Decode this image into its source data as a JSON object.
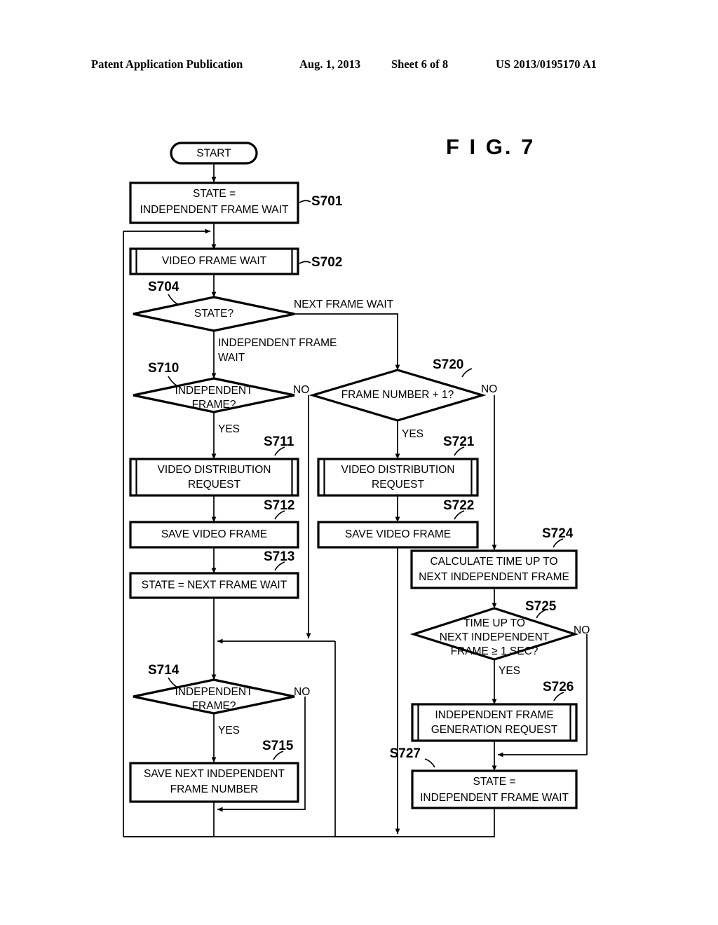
{
  "header": {
    "publication": "Patent Application Publication",
    "date": "Aug. 1, 2013",
    "sheet": "Sheet 6 of 8",
    "patent_number": "US 2013/0195170 A1"
  },
  "figure": {
    "label": "F I G.  7"
  },
  "nodes": {
    "start": {
      "text": "START"
    },
    "s701": {
      "tag": "S701",
      "line1": "STATE =",
      "line2": "INDEPENDENT FRAME WAIT"
    },
    "s702": {
      "tag": "S702",
      "line1": "VIDEO FRAME WAIT"
    },
    "s704": {
      "tag": "S704",
      "line1": "STATE?"
    },
    "s710": {
      "tag": "S710",
      "line1": "INDEPENDENT",
      "line2": "FRAME?"
    },
    "s711": {
      "tag": "S711",
      "line1": "VIDEO DISTRIBUTION",
      "line2": "REQUEST"
    },
    "s712": {
      "tag": "S712",
      "line1": "SAVE VIDEO FRAME"
    },
    "s713": {
      "tag": "S713",
      "line1": "STATE = NEXT FRAME WAIT"
    },
    "s714": {
      "tag": "S714",
      "line1": "INDEPENDENT",
      "line2": "FRAME?"
    },
    "s715": {
      "tag": "S715",
      "line1": "SAVE NEXT INDEPENDENT",
      "line2": "FRAME NUMBER"
    },
    "s720": {
      "tag": "S720",
      "line1": "FRAME NUMBER + 1?"
    },
    "s721": {
      "tag": "S721",
      "line1": "VIDEO DISTRIBUTION",
      "line2": "REQUEST"
    },
    "s722": {
      "tag": "S722",
      "line1": "SAVE VIDEO FRAME"
    },
    "s724": {
      "tag": "S724",
      "line1": "CALCULATE TIME UP TO",
      "line2": "NEXT INDEPENDENT FRAME"
    },
    "s725": {
      "tag": "S725",
      "line1": "TIME UP TO",
      "line2": "NEXT INDEPENDENT",
      "line3": "FRAME ≥ 1 SEC?"
    },
    "s726": {
      "tag": "S726",
      "line1": "INDEPENDENT FRAME",
      "line2": "GENERATION REQUEST"
    },
    "s727": {
      "tag": "S727",
      "line1": "STATE =",
      "line2": "INDEPENDENT FRAME WAIT"
    }
  },
  "edges": {
    "s704_right": "NEXT FRAME WAIT",
    "s704_down_l1": "INDEPENDENT FRAME",
    "s704_down_l2": "WAIT",
    "s710_no": "NO",
    "s710_yes": "YES",
    "s714_no": "NO",
    "s714_yes": "YES",
    "s720_no": "NO",
    "s720_yes": "YES",
    "s725_no": "NO",
    "s725_yes": "YES"
  }
}
